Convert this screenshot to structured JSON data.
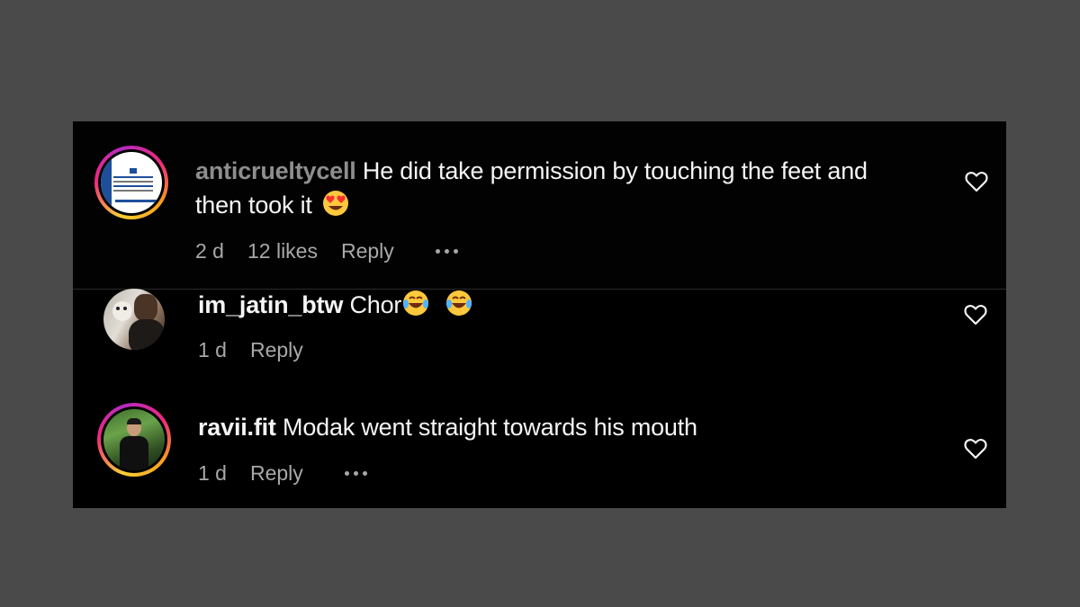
{
  "comments": [
    {
      "username": "anticrueltycell",
      "text": "He did take permission by touching the feet and",
      "text_line2": "then took it",
      "emoji": "heart-eyes",
      "time": "2 d",
      "likes": "12 likes",
      "reply": "Reply"
    },
    {
      "username": "im_jatin_btw",
      "text": "Chor",
      "emoji": "laughing-tears",
      "time": "1 d",
      "reply": "Reply"
    },
    {
      "username": "ravii.fit",
      "text": "Modak went straight towards his mouth",
      "time": "1 d",
      "reply": "Reply"
    }
  ],
  "colors": {
    "background": "#4a4a4a",
    "panel": "#000000",
    "primary_text": "#f5f5f5",
    "secondary_text": "#a8a8a8"
  }
}
